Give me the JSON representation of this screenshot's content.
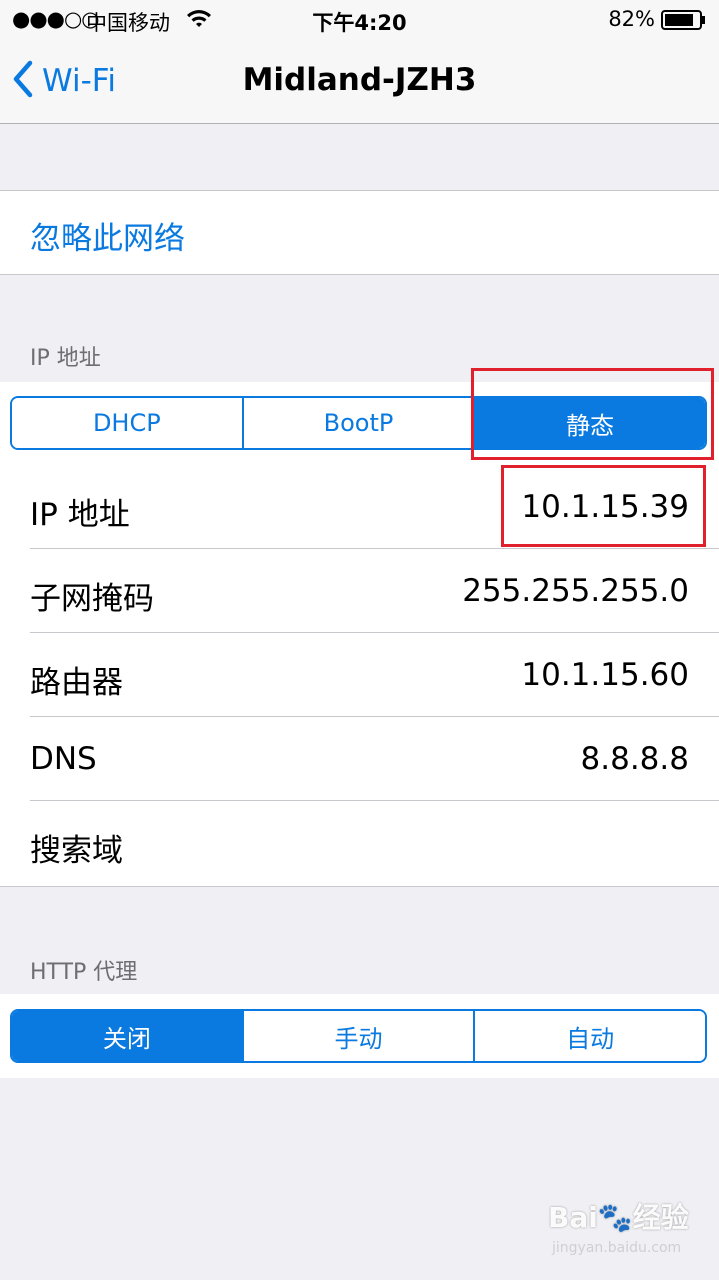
{
  "status_bar": {
    "signal": "●●●○○",
    "carrier": "中国移动",
    "time": "下午4:20",
    "battery": "82%"
  },
  "nav": {
    "back_label": "Wi-Fi",
    "title": "Midland-JZH3"
  },
  "forget_network": "忽略此网络",
  "ip_section": {
    "header": "IP 地址",
    "modes": [
      "DHCP",
      "BootP",
      "静态"
    ],
    "selected_mode": "静态",
    "rows": [
      {
        "label": "IP 地址",
        "value": "10.1.15.39"
      },
      {
        "label": "子网掩码",
        "value": "255.255.255.0"
      },
      {
        "label": "路由器",
        "value": "10.1.15.60"
      },
      {
        "label": "DNS",
        "value": "8.8.8.8"
      },
      {
        "label": "搜索域",
        "value": ""
      }
    ]
  },
  "proxy_section": {
    "header": "HTTP 代理",
    "modes": [
      "关闭",
      "手动",
      "自动"
    ],
    "selected_mode": "关闭"
  },
  "watermark": {
    "brand": "Bai🐾经验",
    "url": "jingyan.baidu.com"
  },
  "colors": {
    "accent": "#0a7ae0",
    "highlight": "#e0202c",
    "background": "#efeff4"
  }
}
